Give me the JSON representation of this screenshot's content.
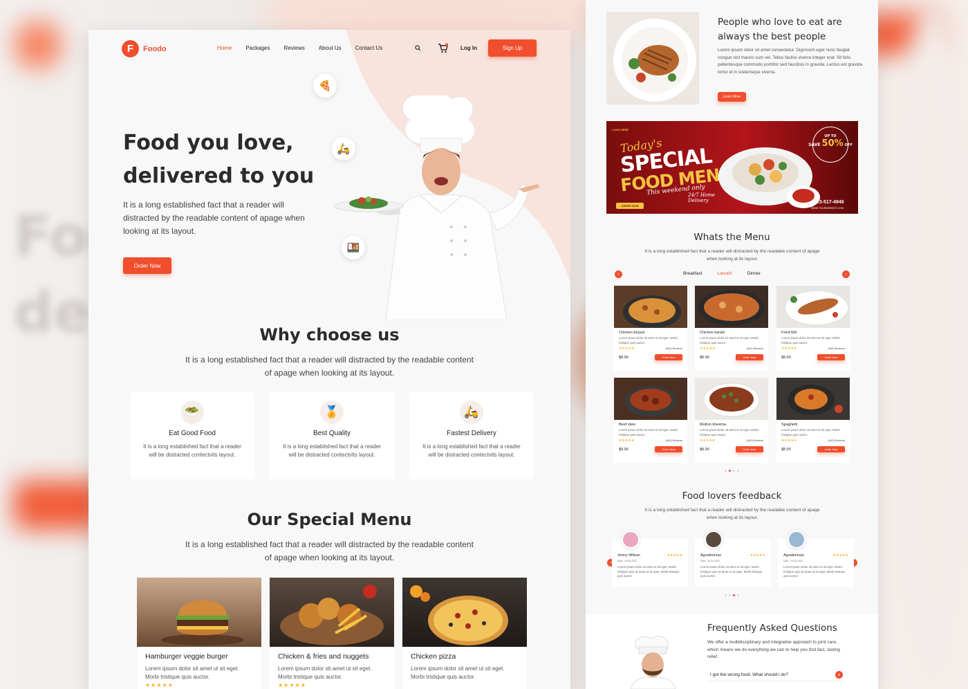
{
  "brand": {
    "name": "Foodo",
    "mark": "F"
  },
  "nav": {
    "links": [
      "Home",
      "Packages",
      "Reviews",
      "About Us",
      "Contact Us"
    ],
    "active": "Home",
    "login": "Log In",
    "signup": "Sign Up",
    "icons": [
      "search-icon",
      "cart-icon"
    ]
  },
  "hero": {
    "title": "Food you love, delivered to you",
    "text": "It is a long established fact that a reader will distracted by the readable content of apage when looking at its layout.",
    "button": "Order Now"
  },
  "why": {
    "title": "Why choose us",
    "text": "It is a long established fact that a reader will distracted by the readable content of apage when looking at its layout.",
    "cards": [
      {
        "name": "Eat Good Food",
        "desc": "It is a long established fact that a reader will be distracted contectvits layout.",
        "icon": "food-icon"
      },
      {
        "name": "Best Quality",
        "desc": "It is a long established fact that a reader will be distracted contectvits layout.",
        "icon": "quality-badge-icon"
      },
      {
        "name": "Fastest Delivery",
        "desc": "It is a long established fact that a reader will be distracted contectvits layout.",
        "icon": "delivery-icon"
      }
    ]
  },
  "special": {
    "title": "Our Special Menu",
    "text": "It is a long established fact that a reader will distracted by the readable content of apage when looking at its layout.",
    "items": [
      {
        "name": "Hamburger veggie burger",
        "desc": "Lorem ipsum dolor sit amet ut sit eget. Morbi tristique quis auctor."
      },
      {
        "name": "Chicken & fries and nuggets",
        "desc": "Lorem ipsum dolor sit amet ut sit eget. Morbi tristique quis auctor."
      },
      {
        "name": "Chicken pizza",
        "desc": "Lorem ipsum dolor sit amet ut sit eget. Morbi tristique quis auctor."
      }
    ]
  },
  "people": {
    "title": "People who love to eat are always the best people",
    "text": "Lorem ipsum dolor sit amet consectetur. Dignissim eget nunc feugiat congue nisl mauris cum vel. Tellus facilisi viverra integer erat. Sit felis pellentesque commodo porttitor sed faucibus in gravida. Lectus est gravida tortor id in scelerisque viverra.",
    "button": "Learn More"
  },
  "banner": {
    "logo": "LOGO HERE",
    "line1": "Today's",
    "line2": "SPECIAL",
    "line3": "FOOD MENU",
    "line4": "This weekend only",
    "badge_top": "UP TO",
    "badge_save": "SAVE",
    "badge_pct": "50%",
    "badge_off": "OFF",
    "delivery": "24/7 Home Delivery",
    "order": "ORDER NOW",
    "phone": "323-517-4946",
    "site": "WWW.YOURWEBSITE.COM"
  },
  "menu": {
    "title": "Whats the Menu",
    "text": "It is a long established fact that a reader will distracted by the readable content of apage when looking at its layout.",
    "tabs": [
      "Breakfast",
      "Lanuch",
      "Dinner"
    ],
    "active_tab": "Lanuch",
    "dishes": [
      {
        "name": "Chicken briyani",
        "desc": "Lorem ipsum dolor sit amet ut sit eget. Morbi tristique quis auctor.",
        "reviews": "(540) Reviews",
        "price": "$8.90",
        "button": "Order Now"
      },
      {
        "name": "Chicken karahi",
        "desc": "Lorem ipsum dolor sit amet ut sit eget. Morbi tristique quis auctor.",
        "reviews": "(540) Reviews",
        "price": "$8.90",
        "button": "Order Now"
      },
      {
        "name": "Fried fish",
        "desc": "Lorem ipsum dolor sit amet ut sit eget. Morbi tristique quis auctor.",
        "reviews": "(540) Reviews",
        "price": "$8.90",
        "button": "Order Now"
      },
      {
        "name": "Beef stew",
        "desc": "Lorem ipsum dolor sit amet ut sit eget. Morbi tristique quis auctor.",
        "reviews": "(540) Reviews",
        "price": "$8.90",
        "button": "Order Now"
      },
      {
        "name": "Mutton kheema",
        "desc": "Lorem ipsum dolor sit amet ut sit eget. Morbi tristique quis auctor.",
        "reviews": "(540) Reviews",
        "price": "$8.90",
        "button": "Order Now"
      },
      {
        "name": "Spaghetti",
        "desc": "Lorem ipsum dolor sit amet ut sit eget. Morbi tristique quis auctor.",
        "reviews": "(540) Reviews",
        "price": "$8.90",
        "button": "Order Now"
      }
    ]
  },
  "feedback": {
    "title": "Food lovers feedback",
    "text": "It is a long established fact that a reader will distracted by the readable content of apage when looking at its layout.",
    "reviews": [
      {
        "name": "Jenny Wilson",
        "date": "Date : 25.08.2022",
        "text": "Lorem ipsum dolor sit amet ut sit eget. Morbi tristique quis sit amet ut sit eget. Morbi tristique quis auctor."
      },
      {
        "name": "Agustinrivas",
        "date": "Date : 20.03.2022",
        "text": "Lorem ipsum dolor sit amet ut sit eget. Morbi tristique quis sit amet ut sit eget. Morbi tristique quis auctor."
      },
      {
        "name": "Agustinrivas",
        "date": "Date : 25.08.2022",
        "text": "Lorem ipsum dolor sit amet ut sit eget. Morbi tristique quis sit amet ut sit eget. Morbi tristique quis auctor."
      }
    ]
  },
  "faq": {
    "title": "Frequently Asked Questions",
    "text": "We offer a multidisciplinary and integrative approach to joint care, which means we do everything we can to help you find fast, lasting relief.",
    "question": "I got the wrong food. What should i do?"
  },
  "colors": {
    "accent": "#f04e2d",
    "star": "#f6b01e",
    "hero_tint": "#f9e4dd"
  }
}
